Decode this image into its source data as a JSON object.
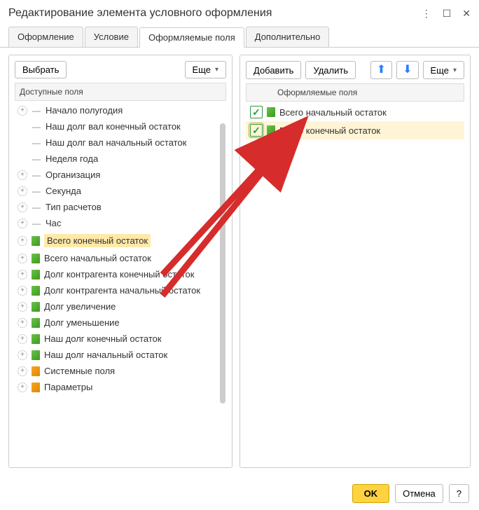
{
  "window": {
    "title": "Редактирование элемента условного оформления"
  },
  "tabs": [
    "Оформление",
    "Условие",
    "Оформляемые поля",
    "Дополнительно"
  ],
  "activeTab": 2,
  "left": {
    "toolbar": {
      "select": "Выбрать",
      "more": "Еще"
    },
    "header": "Доступные поля",
    "items": [
      {
        "exp": "+",
        "dash": "=",
        "icon": "",
        "label": "Начало полугодия"
      },
      {
        "exp": "",
        "dash": "=",
        "icon": "",
        "label": "Наш долг вал конечный остаток"
      },
      {
        "exp": "",
        "dash": "=",
        "icon": "",
        "label": "Наш долг вал начальный остаток"
      },
      {
        "exp": "",
        "dash": "=",
        "icon": "",
        "label": "Неделя года"
      },
      {
        "exp": "+",
        "dash": "=",
        "icon": "",
        "label": "Организация"
      },
      {
        "exp": "+",
        "dash": "=",
        "icon": "",
        "label": "Секунда"
      },
      {
        "exp": "+",
        "dash": "=",
        "icon": "",
        "label": "Тип расчетов"
      },
      {
        "exp": "+",
        "dash": "=",
        "icon": "",
        "label": "Час"
      },
      {
        "exp": "+",
        "dash": "",
        "icon": "green",
        "label": "Всего конечный остаток",
        "sel": true
      },
      {
        "exp": "+",
        "dash": "",
        "icon": "green",
        "label": "Всего начальный остаток"
      },
      {
        "exp": "+",
        "dash": "",
        "icon": "green",
        "label": "Долг контрагента конечный остаток"
      },
      {
        "exp": "+",
        "dash": "",
        "icon": "green",
        "label": "Долг контрагента начальный остаток"
      },
      {
        "exp": "+",
        "dash": "",
        "icon": "green",
        "label": "Долг увеличение"
      },
      {
        "exp": "+",
        "dash": "",
        "icon": "green",
        "label": "Долг уменьшение"
      },
      {
        "exp": "+",
        "dash": "",
        "icon": "green",
        "label": "Наш долг конечный остаток"
      },
      {
        "exp": "+",
        "dash": "",
        "icon": "green",
        "label": "Наш долг начальный остаток"
      },
      {
        "exp": "+",
        "dash": "",
        "icon": "orange",
        "label": "Системные поля"
      },
      {
        "exp": "+",
        "dash": "",
        "icon": "orange",
        "label": "Параметры"
      }
    ]
  },
  "right": {
    "toolbar": {
      "add": "Добавить",
      "del": "Удалить",
      "more": "Еще"
    },
    "header": "Оформляемые поля",
    "items": [
      {
        "checked": true,
        "icon": "green",
        "label": "Всего начальный остаток",
        "sel": false
      },
      {
        "checked": true,
        "icon": "green",
        "label": "Всего конечный остаток",
        "sel": true
      }
    ]
  },
  "footer": {
    "ok": "OK",
    "cancel": "Отмена",
    "help": "?"
  }
}
